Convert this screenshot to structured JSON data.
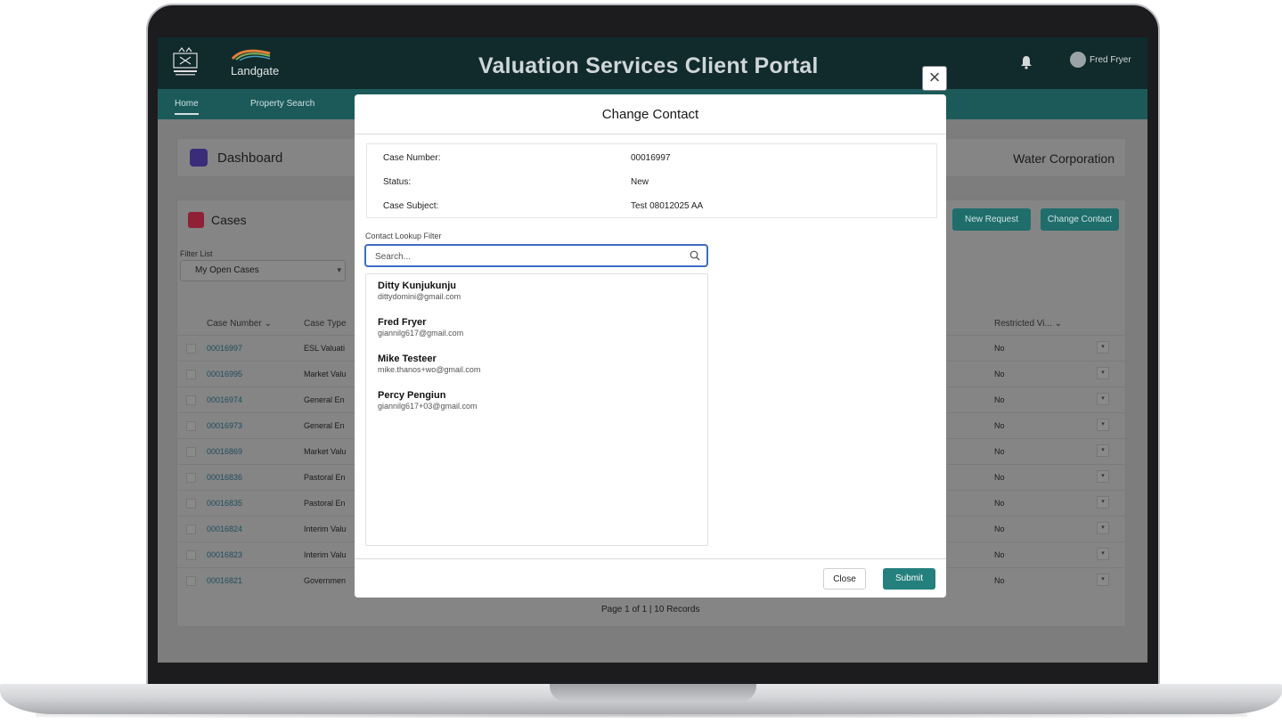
{
  "header": {
    "brand_name": "Landgate",
    "portal_title": "Valuation Services Client Portal",
    "user_name": "Fred Fryer"
  },
  "nav": {
    "home": "Home",
    "property_search": "Property Search"
  },
  "dashboard": {
    "title": "Dashboard",
    "organization": "Water Corporation"
  },
  "cases": {
    "title": "Cases",
    "filter_label": "Filter List",
    "filter_value": "My Open Cases",
    "new_request": "New Request",
    "change_contact": "Change Contact",
    "columns": {
      "case_number": "Case Number",
      "case_type": "Case Type",
      "restricted": "Restricted Vi..."
    },
    "rows": [
      {
        "number": "00016997",
        "type": "ESL Valuati",
        "restricted": "No"
      },
      {
        "number": "00016995",
        "type": "Market Valu",
        "restricted": "No"
      },
      {
        "number": "00016974",
        "type": "General En",
        "restricted": "No"
      },
      {
        "number": "00016973",
        "type": "General En",
        "restricted": "No"
      },
      {
        "number": "00016869",
        "type": "Market Valu",
        "restricted": "No"
      },
      {
        "number": "00016836",
        "type": "Pastoral En",
        "restricted": "No"
      },
      {
        "number": "00016835",
        "type": "Pastoral En",
        "restricted": "No"
      },
      {
        "number": "00016824",
        "type": "Interim Valu",
        "restricted": "No"
      },
      {
        "number": "00016823",
        "type": "Interim Valu",
        "restricted": "No"
      },
      {
        "number": "00016821",
        "type": "Governmen",
        "restricted": "No"
      }
    ],
    "pagination": "Page 1 of 1 | 10 Records"
  },
  "modal": {
    "title": "Change Contact",
    "case_number_label": "Case Number:",
    "case_number": "00016997",
    "status_label": "Status:",
    "status": "New",
    "subject_label": "Case Subject:",
    "subject": "Test 08012025 AA",
    "lookup_label": "Contact Lookup Filter",
    "search_placeholder": "Search...",
    "contacts": [
      {
        "name": "Ditty Kunjukunju",
        "email": "dittydomini@gmail.com"
      },
      {
        "name": "Fred Fryer",
        "email": "giannilg617@gmail.com"
      },
      {
        "name": "Mike Testeer",
        "email": "mike.thanos+wo@gmail.com"
      },
      {
        "name": "Percy Pengiun",
        "email": "giannilg617+03@gmail.com"
      }
    ],
    "close_label": "Close",
    "submit_label": "Submit",
    "close_icon": "×"
  },
  "colors": {
    "header_bg": "#112a2c",
    "nav_bg": "#1c5a5a",
    "accent": "#23807d",
    "focus": "#3d6cc4"
  }
}
